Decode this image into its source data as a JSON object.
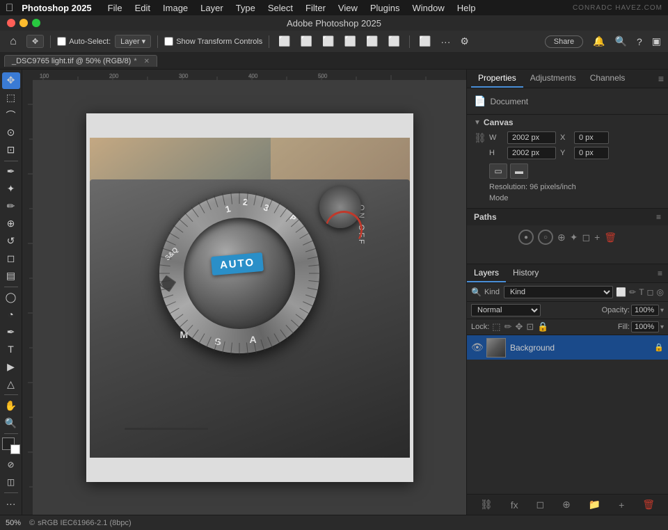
{
  "menubar": {
    "apple": "&#63743;",
    "app_name": "Photoshop 2025",
    "menus": [
      "File",
      "Edit",
      "Image",
      "Layer",
      "Type",
      "Select",
      "Filter",
      "View",
      "Plugins",
      "Window",
      "Help"
    ],
    "watermark": "CONRADC HAVEZ.COM"
  },
  "titlebar": {
    "title": "Adobe Photoshop 2025"
  },
  "optionsbar": {
    "move_icon": "✥",
    "auto_select_label": "Auto-Select:",
    "layer_dropdown": "Layer",
    "show_transform": "Show Transform Controls",
    "align_icons": [
      "⬛",
      "⬛",
      "⬛",
      "⬛",
      "⬛",
      "⬛",
      "⬛",
      "⬛"
    ],
    "more_icon": "···",
    "gear_icon": "⚙",
    "share_label": "Share",
    "bell_icon": "🔔",
    "search_icon": "🔍",
    "help_icon": "?",
    "layout_icon": "▣"
  },
  "tab": {
    "filename": "_DSC9765 light.tif @ 50% (RGB/8)",
    "modified": "*"
  },
  "properties_panel": {
    "tabs": [
      "Properties",
      "Adjustments",
      "Channels"
    ],
    "active_tab": "Properties",
    "document_label": "Document",
    "canvas_section": "Canvas",
    "width_label": "W",
    "height_label": "H",
    "width_value": "2002 px",
    "height_value": "2002 px",
    "x_label": "X",
    "y_label": "Y",
    "x_value": "0 px",
    "y_value": "0 px",
    "resolution_text": "Resolution: 96 pixels/inch",
    "mode_label": "Mode"
  },
  "paths_panel": {
    "title": "Paths"
  },
  "layers_panel": {
    "tabs": [
      "Layers",
      "History"
    ],
    "active_tab": "Layers",
    "filter_label": "Kind",
    "blend_mode": "Normal",
    "opacity_label": "Opacity:",
    "opacity_value": "100%",
    "lock_label": "Lock:",
    "fill_label": "Fill:",
    "fill_value": "100%",
    "layers": [
      {
        "name": "Background",
        "visible": true,
        "locked": true
      }
    ]
  },
  "statusbar": {
    "zoom": "50%",
    "color_profile": "sRGB IEC61966-2.1 (8bpc)"
  },
  "canvas": {
    "auto_label": "AUTO"
  }
}
